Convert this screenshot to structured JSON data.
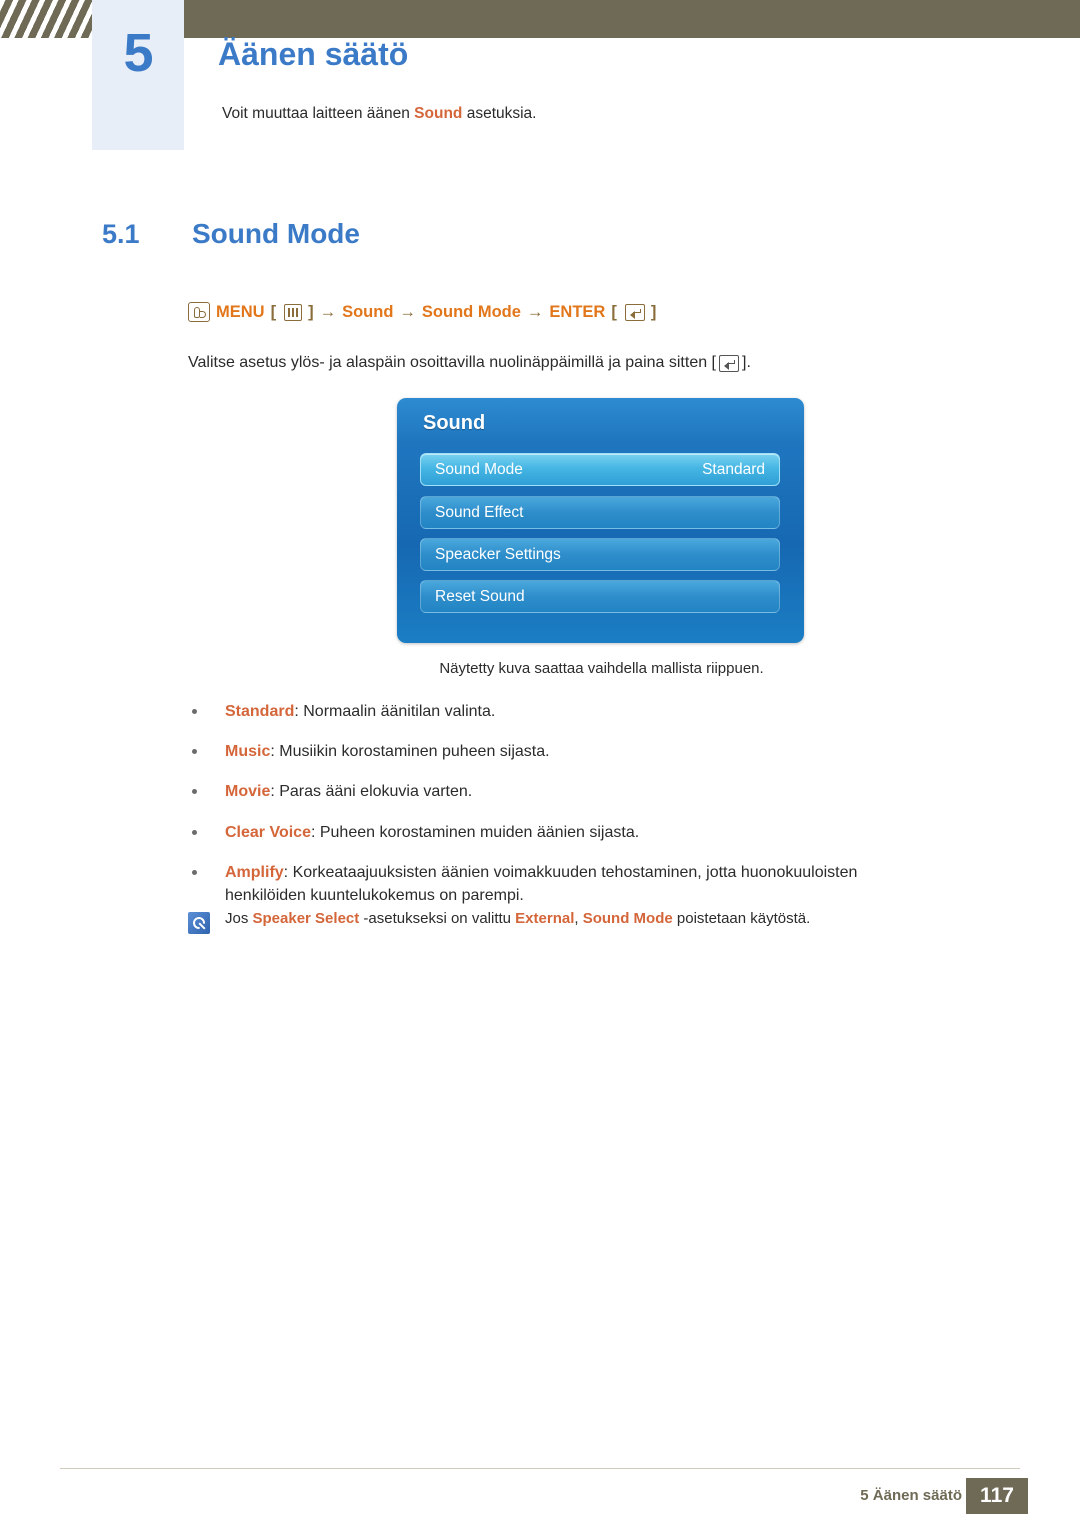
{
  "header": {
    "chapter_number": "5",
    "chapter_title": "Äänen säätö",
    "chapter_sub_before": "Voit muuttaa laitteen äänen ",
    "chapter_sub_hl": "Sound",
    "chapter_sub_after": " asetuksia."
  },
  "section": {
    "number": "5.1",
    "title": "Sound Mode"
  },
  "menu_path": {
    "hand_icon": "hand-press-icon",
    "menu_label": "MENU",
    "menu_bars_icon": "menu-bars-icon",
    "arrow1": "→",
    "item1": "Sound",
    "arrow2": "→",
    "item2": "Sound Mode",
    "arrow3": "→",
    "enter_label": "ENTER",
    "enter_icon": "enter-key-icon",
    "bracket_open": "[",
    "bracket_close": "]"
  },
  "instruction": {
    "before": "Valitse asetus ylös- ja alaspäin osoittavilla nuolinäppäimillä ja paina sitten [",
    "after": "]."
  },
  "osd": {
    "title": "Sound",
    "rows": [
      {
        "label": "Sound Mode",
        "value": "Standard",
        "selected": true
      },
      {
        "label": "Sound Effect",
        "value": "",
        "selected": false
      },
      {
        "label": "Speacker Settings",
        "value": "",
        "selected": false
      },
      {
        "label": "Reset Sound",
        "value": "",
        "selected": false
      }
    ],
    "caption": "Näytetty kuva saattaa vaihdella mallista riippuen."
  },
  "bullets": [
    {
      "term": "Standard",
      "text": ": Normaalin äänitilan valinta."
    },
    {
      "term": "Music",
      "text": ": Musiikin korostaminen puheen sijasta."
    },
    {
      "term": "Movie",
      "text": ": Paras ääni elokuvia varten."
    },
    {
      "term": "Clear Voice",
      "text": ": Puheen korostaminen muiden äänien sijasta."
    },
    {
      "term": "Amplify",
      "text": ": Korkeataajuuksisten äänien voimakkuuden tehostaminen, jotta huonokuuloisten henkilöiden kuuntelukokemus on parempi."
    }
  ],
  "note": {
    "p1": "Jos ",
    "hl1": "Speaker Select",
    "p2": " -asetukseksi on valittu ",
    "hl2": "External",
    "p3": ", ",
    "hl3": "Sound Mode",
    "p4": " poistetaan käytöstä."
  },
  "footer": {
    "text": "5 Äänen säätö",
    "page": "117"
  },
  "colors": {
    "accent_blue": "#3b7ac7",
    "orange": "#d4663a",
    "path_orange": "#e2761b",
    "olive": "#6f6a55",
    "osd_blue": "#1f76bf"
  }
}
